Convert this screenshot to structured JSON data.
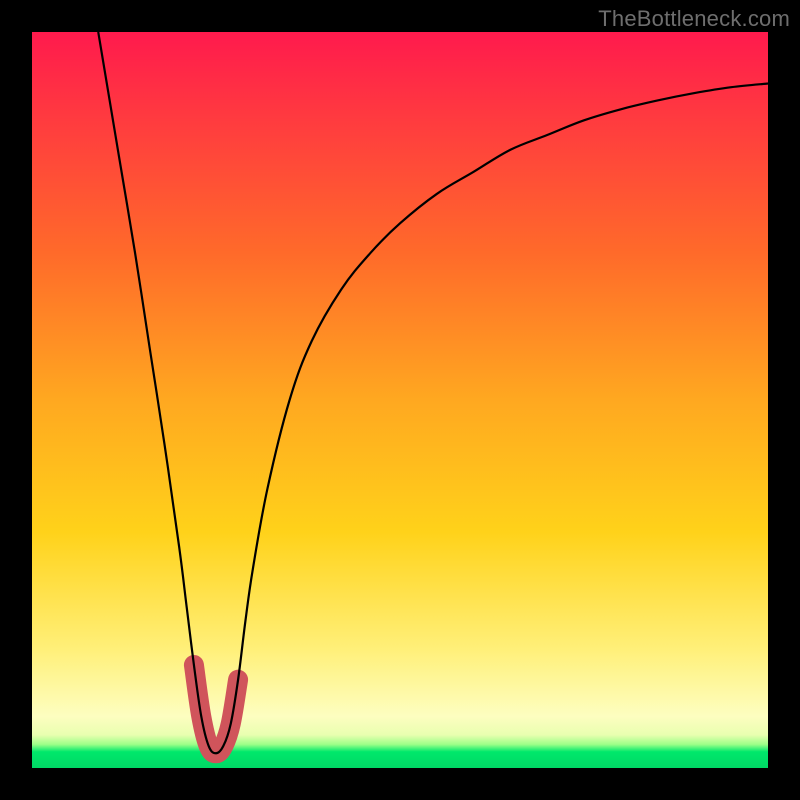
{
  "watermark": "TheBottleneck.com",
  "chart_data": {
    "type": "line",
    "title": "",
    "xlabel": "",
    "ylabel": "",
    "xlim": [
      0,
      100
    ],
    "ylim": [
      0,
      100
    ],
    "series": [
      {
        "name": "curve",
        "x": [
          9,
          10,
          12,
          14,
          16,
          18,
          20,
          21,
          22,
          23,
          24,
          25,
          26,
          27,
          28,
          29,
          30,
          32,
          35,
          38,
          42,
          46,
          50,
          55,
          60,
          65,
          70,
          75,
          80,
          85,
          90,
          95,
          100
        ],
        "y": [
          100,
          94,
          82,
          70,
          57,
          44,
          30,
          22,
          14,
          7,
          3,
          2,
          3,
          6,
          12,
          20,
          27,
          38,
          50,
          58,
          65,
          70,
          74,
          78,
          81,
          84,
          86,
          88,
          89.5,
          90.7,
          91.7,
          92.5,
          93
        ]
      }
    ],
    "highlight": {
      "name": "minimum-band",
      "x": [
        22,
        23,
        24,
        25,
        26,
        27,
        28
      ],
      "y": [
        14,
        7,
        3,
        2,
        3,
        6,
        12
      ],
      "color": "#d0545b",
      "stroke_width_px": 20
    },
    "colors": {
      "curve": "#000000",
      "highlight": "#d0545b",
      "gradient_top": "#ff1a4d",
      "gradient_bottom": "#00d865"
    }
  }
}
